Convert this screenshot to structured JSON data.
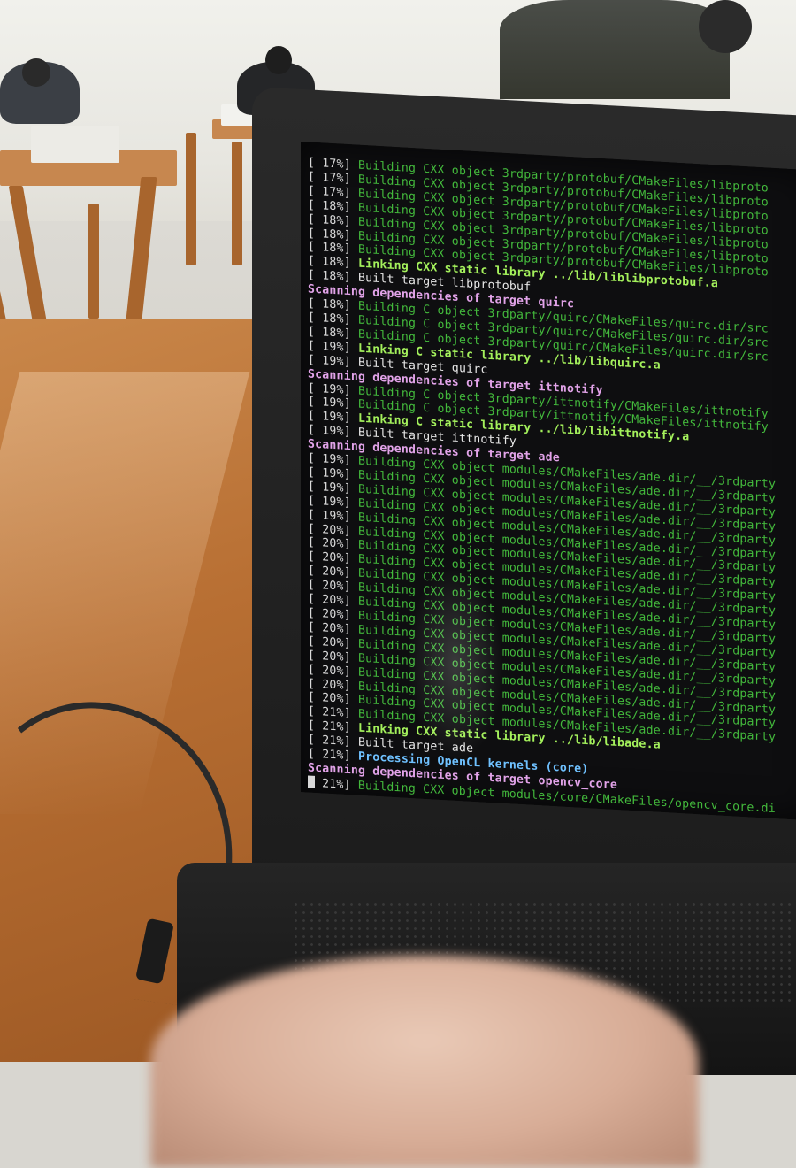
{
  "terminal": {
    "lines": [
      {
        "pct": "[ 17%]",
        "text": "Building CXX object 3rdparty/protobuf/CMakeFiles/libproto",
        "style": "g"
      },
      {
        "pct": "[ 17%]",
        "text": "Building CXX object 3rdparty/protobuf/CMakeFiles/libproto",
        "style": "g"
      },
      {
        "pct": "[ 17%]",
        "text": "Building CXX object 3rdparty/protobuf/CMakeFiles/libproto",
        "style": "g"
      },
      {
        "pct": "[ 18%]",
        "text": "Building CXX object 3rdparty/protobuf/CMakeFiles/libproto",
        "style": "g"
      },
      {
        "pct": "[ 18%]",
        "text": "Building CXX object 3rdparty/protobuf/CMakeFiles/libproto",
        "style": "g"
      },
      {
        "pct": "[ 18%]",
        "text": "Building CXX object 3rdparty/protobuf/CMakeFiles/libproto",
        "style": "g"
      },
      {
        "pct": "[ 18%]",
        "text": "Building CXX object 3rdparty/protobuf/CMakeFiles/libproto",
        "style": "g"
      },
      {
        "pct": "[ 18%]",
        "text": "Linking CXX static library ../lib/liblibprotobuf.a",
        "style": "lg"
      },
      {
        "pct": "[ 18%]",
        "text": "Built target libprotobuf",
        "style": "w"
      },
      {
        "pct": "",
        "text": "Scanning dependencies of target quirc",
        "style": "mag"
      },
      {
        "pct": "[ 18%]",
        "text": "Building C object 3rdparty/quirc/CMakeFiles/quirc.dir/src",
        "style": "g"
      },
      {
        "pct": "[ 18%]",
        "text": "Building C object 3rdparty/quirc/CMakeFiles/quirc.dir/src",
        "style": "g"
      },
      {
        "pct": "[ 18%]",
        "text": "Building C object 3rdparty/quirc/CMakeFiles/quirc.dir/src",
        "style": "g"
      },
      {
        "pct": "[ 19%]",
        "text": "Linking C static library ../lib/libquirc.a",
        "style": "lg"
      },
      {
        "pct": "[ 19%]",
        "text": "Built target quirc",
        "style": "w"
      },
      {
        "pct": "",
        "text": "Scanning dependencies of target ittnotify",
        "style": "mag"
      },
      {
        "pct": "[ 19%]",
        "text": "Building C object 3rdparty/ittnotify/CMakeFiles/ittnotify",
        "style": "g"
      },
      {
        "pct": "[ 19%]",
        "text": "Building C object 3rdparty/ittnotify/CMakeFiles/ittnotify",
        "style": "g"
      },
      {
        "pct": "[ 19%]",
        "text": "Linking C static library ../lib/libittnotify.a",
        "style": "lg"
      },
      {
        "pct": "[ 19%]",
        "text": "Built target ittnotify",
        "style": "w"
      },
      {
        "pct": "",
        "text": "Scanning dependencies of target ade",
        "style": "mag"
      },
      {
        "pct": "[ 19%]",
        "text": "Building CXX object modules/CMakeFiles/ade.dir/__/3rdparty",
        "style": "g"
      },
      {
        "pct": "[ 19%]",
        "text": "Building CXX object modules/CMakeFiles/ade.dir/__/3rdparty",
        "style": "g"
      },
      {
        "pct": "[ 19%]",
        "text": "Building CXX object modules/CMakeFiles/ade.dir/__/3rdparty",
        "style": "g"
      },
      {
        "pct": "[ 19%]",
        "text": "Building CXX object modules/CMakeFiles/ade.dir/__/3rdparty",
        "style": "g"
      },
      {
        "pct": "[ 19%]",
        "text": "Building CXX object modules/CMakeFiles/ade.dir/__/3rdparty",
        "style": "g"
      },
      {
        "pct": "[ 20%]",
        "text": "Building CXX object modules/CMakeFiles/ade.dir/__/3rdparty",
        "style": "g"
      },
      {
        "pct": "[ 20%]",
        "text": "Building CXX object modules/CMakeFiles/ade.dir/__/3rdparty",
        "style": "g"
      },
      {
        "pct": "[ 20%]",
        "text": "Building CXX object modules/CMakeFiles/ade.dir/__/3rdparty",
        "style": "g"
      },
      {
        "pct": "[ 20%]",
        "text": "Building CXX object modules/CMakeFiles/ade.dir/__/3rdparty",
        "style": "g"
      },
      {
        "pct": "[ 20%]",
        "text": "Building CXX object modules/CMakeFiles/ade.dir/__/3rdparty",
        "style": "g"
      },
      {
        "pct": "[ 20%]",
        "text": "Building CXX object modules/CMakeFiles/ade.dir/__/3rdparty",
        "style": "g"
      },
      {
        "pct": "[ 20%]",
        "text": "Building CXX object modules/CMakeFiles/ade.dir/__/3rdparty",
        "style": "g"
      },
      {
        "pct": "[ 20%]",
        "text": "Building CXX object modules/CMakeFiles/ade.dir/__/3rdparty",
        "style": "g"
      },
      {
        "pct": "[ 20%]",
        "text": "Building CXX object modules/CMakeFiles/ade.dir/__/3rdparty",
        "style": "g"
      },
      {
        "pct": "[ 20%]",
        "text": "Building CXX object modules/CMakeFiles/ade.dir/__/3rdparty",
        "style": "g"
      },
      {
        "pct": "[ 20%]",
        "text": "Building CXX object modules/CMakeFiles/ade.dir/__/3rdparty",
        "style": "g"
      },
      {
        "pct": "[ 20%]",
        "text": "Building CXX object modules/CMakeFiles/ade.dir/__/3rdparty",
        "style": "g"
      },
      {
        "pct": "[ 20%]",
        "text": "Building CXX object modules/CMakeFiles/ade.dir/__/3rdparty",
        "style": "g"
      },
      {
        "pct": "[ 21%]",
        "text": "Building CXX object modules/CMakeFiles/ade.dir/__/3rdparty",
        "style": "g"
      },
      {
        "pct": "[ 21%]",
        "text": "Linking CXX static library ../lib/libade.a",
        "style": "lg"
      },
      {
        "pct": "[ 21%]",
        "text": "Built target ade",
        "style": "w"
      },
      {
        "pct": "[ 21%]",
        "text": "Processing OpenCL kernels (core)",
        "style": "bl"
      },
      {
        "pct": "",
        "text": "Scanning dependencies of target opencv_core",
        "style": "mag"
      },
      {
        "pct": "[ 21%]",
        "text": "Building CXX object modules/core/CMakeFiles/opencv_core.di",
        "style": "g",
        "cursor": true
      }
    ]
  }
}
